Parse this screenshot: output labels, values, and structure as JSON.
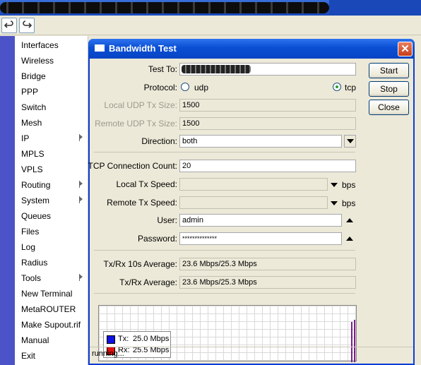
{
  "toolbar": {
    "undo_icon": "undo-icon",
    "redo_icon": "redo-icon"
  },
  "menu": {
    "items": [
      {
        "label": "Interfaces",
        "submenu": false
      },
      {
        "label": "Wireless",
        "submenu": false
      },
      {
        "label": "Bridge",
        "submenu": false
      },
      {
        "label": "PPP",
        "submenu": false
      },
      {
        "label": "Switch",
        "submenu": false
      },
      {
        "label": "Mesh",
        "submenu": false
      },
      {
        "label": "IP",
        "submenu": true
      },
      {
        "label": "MPLS",
        "submenu": false
      },
      {
        "label": "VPLS",
        "submenu": false
      },
      {
        "label": "Routing",
        "submenu": true
      },
      {
        "label": "System",
        "submenu": true
      },
      {
        "label": "Queues",
        "submenu": false
      },
      {
        "label": "Files",
        "submenu": false
      },
      {
        "label": "Log",
        "submenu": false
      },
      {
        "label": "Radius",
        "submenu": false
      },
      {
        "label": "Tools",
        "submenu": true
      },
      {
        "label": "New Terminal",
        "submenu": false
      },
      {
        "label": "MetaROUTER",
        "submenu": false
      },
      {
        "label": "Make Supout.rif",
        "submenu": false
      },
      {
        "label": "Manual",
        "submenu": false
      },
      {
        "label": "Exit",
        "submenu": false
      }
    ]
  },
  "dialog": {
    "title": "Bandwidth Test",
    "test_to_label": "Test To:",
    "protocol_label": "Protocol:",
    "protocol_udp": "udp",
    "protocol_tcp": "tcp",
    "protocol_selected": "tcp",
    "local_udp_label": "Local UDP Tx Size:",
    "local_udp_value": "1500",
    "remote_udp_label": "Remote UDP Tx Size:",
    "remote_udp_value": "1500",
    "direction_label": "Direction:",
    "direction_value": "both",
    "tcp_count_label": "TCP Connection Count:",
    "tcp_count_value": "20",
    "local_tx_label": "Local Tx Speed:",
    "remote_tx_label": "Remote Tx Speed:",
    "unit": "bps",
    "user_label": "User:",
    "user_value": "admin",
    "password_label": "Password:",
    "password_value": "**************",
    "avg10_label": "Tx/Rx 10s Average:",
    "avg10_value": "23.6 Mbps/25.3 Mbps",
    "avg_label": "Tx/Rx Average:",
    "avg_value": "23.6 Mbps/25.3 Mbps",
    "buttons": {
      "start": "Start",
      "stop": "Stop",
      "close": "Close"
    },
    "status": "running..."
  },
  "graph": {
    "legend": [
      {
        "label": "Tx:",
        "value": "25.0 Mbps",
        "color": "#1010e0"
      },
      {
        "label": "Rx:",
        "value": "25.5 Mbps",
        "color": "#e01010"
      }
    ],
    "bar_color": "#7a1f8c"
  }
}
